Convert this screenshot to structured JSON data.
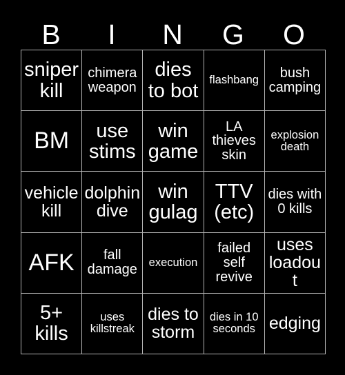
{
  "header": {
    "letters": [
      "B",
      "I",
      "N",
      "G",
      "O"
    ]
  },
  "colors": {
    "background": "#000000",
    "text": "#ffffff",
    "gridline": "#b4b4b4"
  },
  "grid": {
    "columns": 5,
    "rows": 5,
    "cells": [
      {
        "text": "sniper kill",
        "size": "lg"
      },
      {
        "text": "chimera weapon",
        "size": "sm"
      },
      {
        "text": "dies to bot",
        "size": "lg"
      },
      {
        "text": "flashbang",
        "size": "xs"
      },
      {
        "text": "bush camping",
        "size": "sm"
      },
      {
        "text": "BM",
        "size": "xl"
      },
      {
        "text": "use stims",
        "size": "lg"
      },
      {
        "text": "win game",
        "size": "lg"
      },
      {
        "text": "LA thieves skin",
        "size": "sm"
      },
      {
        "text": "explosion death",
        "size": "xs"
      },
      {
        "text": "vehicle kill",
        "size": "md"
      },
      {
        "text": "dolphin dive",
        "size": "md"
      },
      {
        "text": "win gulag",
        "size": "lg"
      },
      {
        "text": "TTV (etc)",
        "size": "lg"
      },
      {
        "text": "dies with 0 kills",
        "size": "sm"
      },
      {
        "text": "AFK",
        "size": "xl"
      },
      {
        "text": "fall damage",
        "size": "sm"
      },
      {
        "text": "execution",
        "size": "xs"
      },
      {
        "text": "failed self revive",
        "size": "sm"
      },
      {
        "text": "uses loadout",
        "size": "md"
      },
      {
        "text": "5+ kills",
        "size": "lg"
      },
      {
        "text": "uses killstreak",
        "size": "xs"
      },
      {
        "text": "dies to storm",
        "size": "md"
      },
      {
        "text": "dies in 10 seconds",
        "size": "xs"
      },
      {
        "text": "edging",
        "size": "md"
      }
    ]
  }
}
